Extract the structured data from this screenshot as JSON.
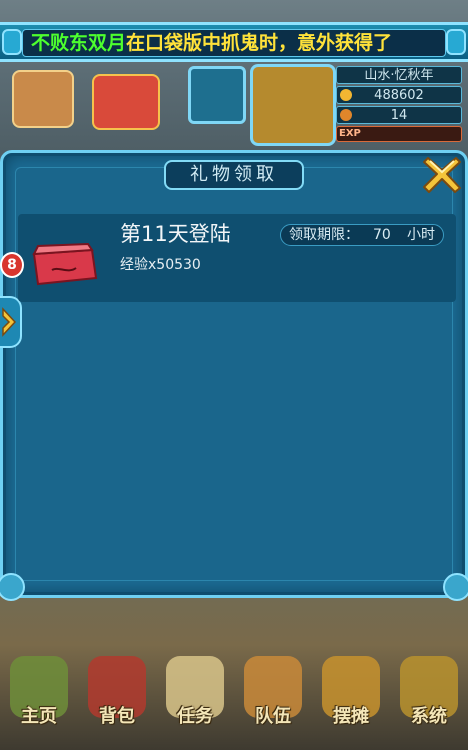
{
  "ticker": {
    "player_name": "不败东双月",
    "message": "在口袋版中抓鬼时，意外获得了"
  },
  "player": {
    "name": "山水·忆秋年",
    "gold": "488602",
    "level": "14",
    "exp_label": "EXP"
  },
  "dialog": {
    "title": "礼物领取",
    "reward": {
      "badge_count": "8",
      "title": "第11天登陆",
      "detail": "经验x50530",
      "deadline_label": "领取期限：",
      "deadline_value": "70",
      "deadline_unit": "小时"
    }
  },
  "menu": {
    "items": [
      {
        "label": "主页",
        "icon": "home-icon"
      },
      {
        "label": "背包",
        "icon": "bag-icon"
      },
      {
        "label": "任务",
        "icon": "quest-scroll-icon"
      },
      {
        "label": "队伍",
        "icon": "team-icon"
      },
      {
        "label": "摆摊",
        "icon": "stall-icon"
      },
      {
        "label": "系统",
        "icon": "gear-icon"
      }
    ]
  },
  "colors": {
    "panel": "#1c6b93",
    "border": "#6fd0f2",
    "ticker_name": "#4dff2e",
    "ticker_msg": "#ffe23a"
  }
}
